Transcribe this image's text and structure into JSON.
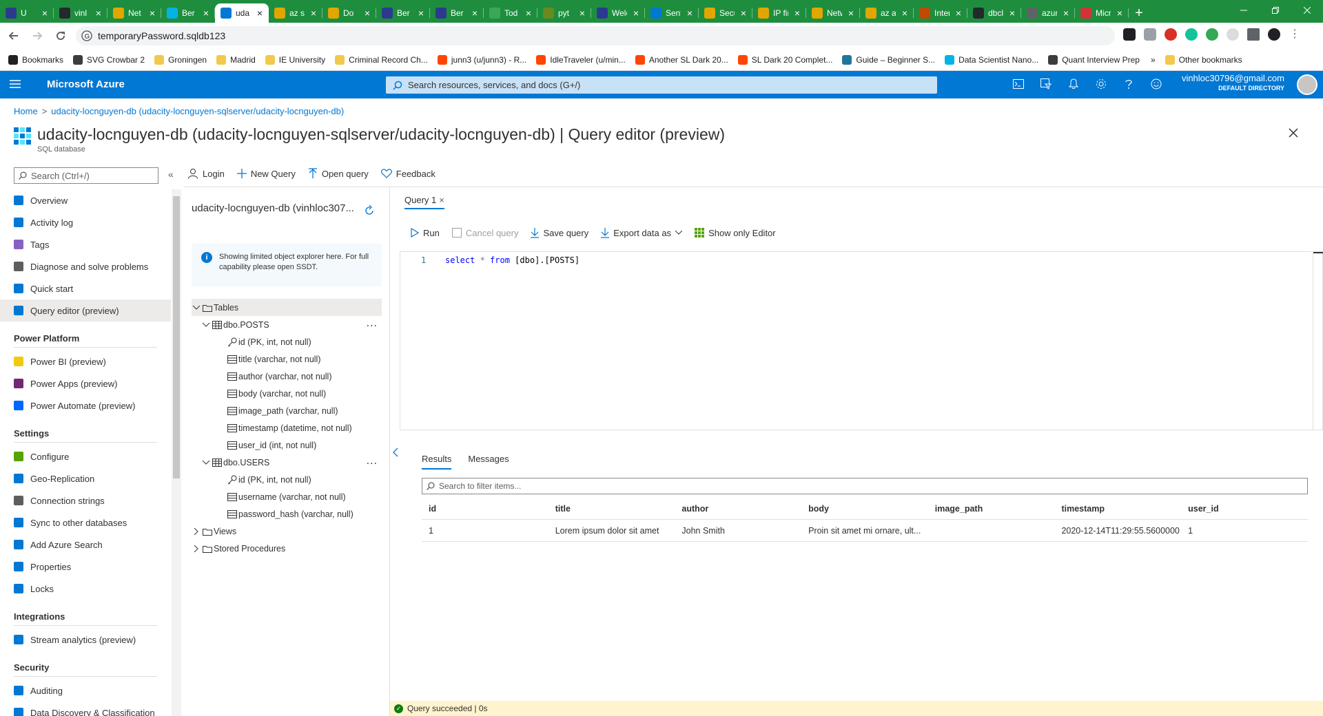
{
  "browser": {
    "tabs": [
      {
        "title": "U",
        "color": "#2b3a8f",
        "active": false
      },
      {
        "title": "vinl",
        "color": "#24292e",
        "active": false
      },
      {
        "title": "Net",
        "color": "#e2a600",
        "active": false
      },
      {
        "title": "Ber",
        "color": "#02b3e4",
        "active": false
      },
      {
        "title": "uda",
        "color": "#0078d4",
        "active": true
      },
      {
        "title": "az s",
        "color": "#e2a600",
        "active": false
      },
      {
        "title": "Do",
        "color": "#e2a600",
        "active": false
      },
      {
        "title": "Ber",
        "color": "#2b3a8f",
        "active": false
      },
      {
        "title": "Ber",
        "color": "#2b3a8f",
        "active": false
      },
      {
        "title": "Tod",
        "color": "#3aa757",
        "active": false
      },
      {
        "title": "pyt",
        "color": "#6a8a1e",
        "active": false
      },
      {
        "title": "Welcom",
        "color": "#2b3a8f",
        "active": false
      },
      {
        "title": "Sent Ma",
        "color": "#0078d4",
        "active": false
      },
      {
        "title": "Secure",
        "color": "#e2a600",
        "active": false
      },
      {
        "title": "IP firew",
        "color": "#e2a600",
        "active": false
      },
      {
        "title": "Networ",
        "color": "#e2a600",
        "active": false
      },
      {
        "title": "az acco",
        "color": "#e2a600",
        "active": false
      },
      {
        "title": "Interact",
        "color": "#c04a00",
        "active": false
      },
      {
        "title": "dbcli/m",
        "color": "#24292e",
        "active": false
      },
      {
        "title": "azure sc",
        "color": "#5f6368",
        "active": false
      },
      {
        "title": "Microsc",
        "color": "#d13438",
        "active": false
      }
    ],
    "tab_close": "×",
    "new_tab": "+",
    "address": "temporaryPassword.sqldb123",
    "bookmarks": [
      {
        "label": "Bookmarks",
        "color": "#202124"
      },
      {
        "label": "SVG Crowbar 2",
        "color": "#3c3c3c"
      },
      {
        "label": "Groningen",
        "color": "#f2c94c"
      },
      {
        "label": "Madrid",
        "color": "#f2c94c"
      },
      {
        "label": "IE University",
        "color": "#f2c94c"
      },
      {
        "label": "Criminal Record Ch...",
        "color": "#f2c94c"
      },
      {
        "label": "junn3 (u/junn3) - R...",
        "color": "#ff4500"
      },
      {
        "label": "IdleTraveler (u/min...",
        "color": "#ff4500"
      },
      {
        "label": "Another SL Dark 20...",
        "color": "#ff4500"
      },
      {
        "label": "SL Dark 20 Complet...",
        "color": "#ff4500"
      },
      {
        "label": "Guide – Beginner S...",
        "color": "#21759b"
      },
      {
        "label": "Data Scientist Nano...",
        "color": "#02b3e4"
      },
      {
        "label": "Quant Interview Prep",
        "color": "#3c3c3c"
      }
    ],
    "bookmarks_more": "»",
    "other_bookmarks": "Other bookmarks"
  },
  "azure": {
    "brand": "Microsoft Azure",
    "search_placeholder": "Search resources, services, and docs (G+/)",
    "user_email": "vinhloc30796@gmail.com",
    "user_dir": "DEFAULT DIRECTORY",
    "accent": "#0078d4"
  },
  "breadcrumb": {
    "home": "Home",
    "sep": ">",
    "db": "udacity-locnguyen-db (udacity-locnguyen-sqlserver/udacity-locnguyen-db)"
  },
  "page": {
    "title": "udacity-locnguyen-db (udacity-locnguyen-sqlserver/udacity-locnguyen-db)",
    "title_suffix": "| Query editor (preview)",
    "subtitle": "SQL database"
  },
  "nav": {
    "search_placeholder": "Search (Ctrl+/)",
    "collapse": "«",
    "sections": [
      {
        "heading": "",
        "items": [
          {
            "label": "Overview",
            "icon": "sql-db-icon",
            "color": "#0078d4"
          },
          {
            "label": "Activity log",
            "icon": "activity-log-icon",
            "color": "#0078d4"
          },
          {
            "label": "Tags",
            "icon": "tag-icon",
            "color": "#8661c5"
          },
          {
            "label": "Diagnose and solve problems",
            "icon": "wrench-icon",
            "color": "#605e5c"
          },
          {
            "label": "Quick start",
            "icon": "cloud-icon",
            "color": "#0078d4"
          },
          {
            "label": "Query editor (preview)",
            "icon": "query-editor-icon",
            "color": "#0078d4",
            "selected": true
          }
        ]
      },
      {
        "heading": "Power Platform",
        "items": [
          {
            "label": "Power BI (preview)",
            "icon": "power-bi-icon",
            "color": "#f2c811"
          },
          {
            "label": "Power Apps (preview)",
            "icon": "power-apps-icon",
            "color": "#742774"
          },
          {
            "label": "Power Automate (preview)",
            "icon": "power-automate-icon",
            "color": "#0066ff"
          }
        ]
      },
      {
        "heading": "Settings",
        "items": [
          {
            "label": "Configure",
            "icon": "configure-icon",
            "color": "#57a300"
          },
          {
            "label": "Geo-Replication",
            "icon": "globe-icon",
            "color": "#0078d4"
          },
          {
            "label": "Connection strings",
            "icon": "plug-icon",
            "color": "#605e5c"
          },
          {
            "label": "Sync to other databases",
            "icon": "sync-icon",
            "color": "#0078d4"
          },
          {
            "label": "Add Azure Search",
            "icon": "cloud-search-icon",
            "color": "#0078d4"
          },
          {
            "label": "Properties",
            "icon": "properties-icon",
            "color": "#0078d4"
          },
          {
            "label": "Locks",
            "icon": "lock-icon",
            "color": "#0078d4"
          }
        ]
      },
      {
        "heading": "Integrations",
        "items": [
          {
            "label": "Stream analytics (preview)",
            "icon": "stream-analytics-icon",
            "color": "#0078d4"
          }
        ]
      },
      {
        "heading": "Security",
        "items": [
          {
            "label": "Auditing",
            "icon": "auditing-icon",
            "color": "#0078d4"
          },
          {
            "label": "Data Discovery & Classification",
            "icon": "classification-icon",
            "color": "#0078d4"
          }
        ]
      }
    ]
  },
  "toolbar": {
    "login": "Login",
    "new_query": "New Query",
    "open_query": "Open query",
    "feedback": "Feedback"
  },
  "explorer": {
    "db_label": "udacity-locnguyen-db (vinhloc307...",
    "info": "Showing limited object explorer here. For full capability please open SSDT.",
    "info_icon": "i",
    "tree": [
      {
        "label": "Tables",
        "level": 0,
        "chev": "open",
        "icon": "folder",
        "hl": true
      },
      {
        "label": "dbo.POSTS",
        "level": 1,
        "chev": "open",
        "icon": "table",
        "more": true
      },
      {
        "label": "id (PK, int, not null)",
        "level": 2,
        "icon": "key"
      },
      {
        "label": "title (varchar, not null)",
        "level": 2,
        "icon": "column"
      },
      {
        "label": "author (varchar, not null)",
        "level": 2,
        "icon": "column"
      },
      {
        "label": "body (varchar, not null)",
        "level": 2,
        "icon": "column"
      },
      {
        "label": "image_path (varchar, null)",
        "level": 2,
        "icon": "column"
      },
      {
        "label": "timestamp (datetime, not null)",
        "level": 2,
        "icon": "column"
      },
      {
        "label": "user_id (int, not null)",
        "level": 2,
        "icon": "column"
      },
      {
        "label": "dbo.USERS",
        "level": 1,
        "chev": "open",
        "icon": "table",
        "more": true
      },
      {
        "label": "id (PK, int, not null)",
        "level": 2,
        "icon": "key"
      },
      {
        "label": "username (varchar, not null)",
        "level": 2,
        "icon": "column"
      },
      {
        "label": "password_hash (varchar, null)",
        "level": 2,
        "icon": "column"
      },
      {
        "label": "Views",
        "level": 0,
        "chev": "closed",
        "icon": "folder"
      },
      {
        "label": "Stored Procedures",
        "level": 0,
        "chev": "closed",
        "icon": "folder"
      }
    ],
    "more": "..."
  },
  "editor": {
    "tab_label": "Query 1",
    "tab_close": "×",
    "run": "Run",
    "cancel": "Cancel query",
    "save": "Save query",
    "export": "Export data as",
    "show_only": "Show only Editor",
    "line_number": "1",
    "code_kw1": "select",
    "code_star": " * ",
    "code_kw2": "from",
    "code_rest": " [dbo].[POSTS]"
  },
  "results": {
    "tab_results": "Results",
    "tab_messages": "Messages",
    "filter_placeholder": "Search to filter items...",
    "columns": [
      "id",
      "title",
      "author",
      "body",
      "image_path",
      "timestamp",
      "user_id"
    ],
    "rows": [
      [
        "1",
        "Lorem ipsum dolor sit amet",
        "John Smith",
        "Proin sit amet mi ornare, ult...",
        "",
        "2020-12-14T11:29:55.5600000",
        "1"
      ]
    ]
  },
  "status": {
    "text": "Query succeeded | 0s"
  }
}
